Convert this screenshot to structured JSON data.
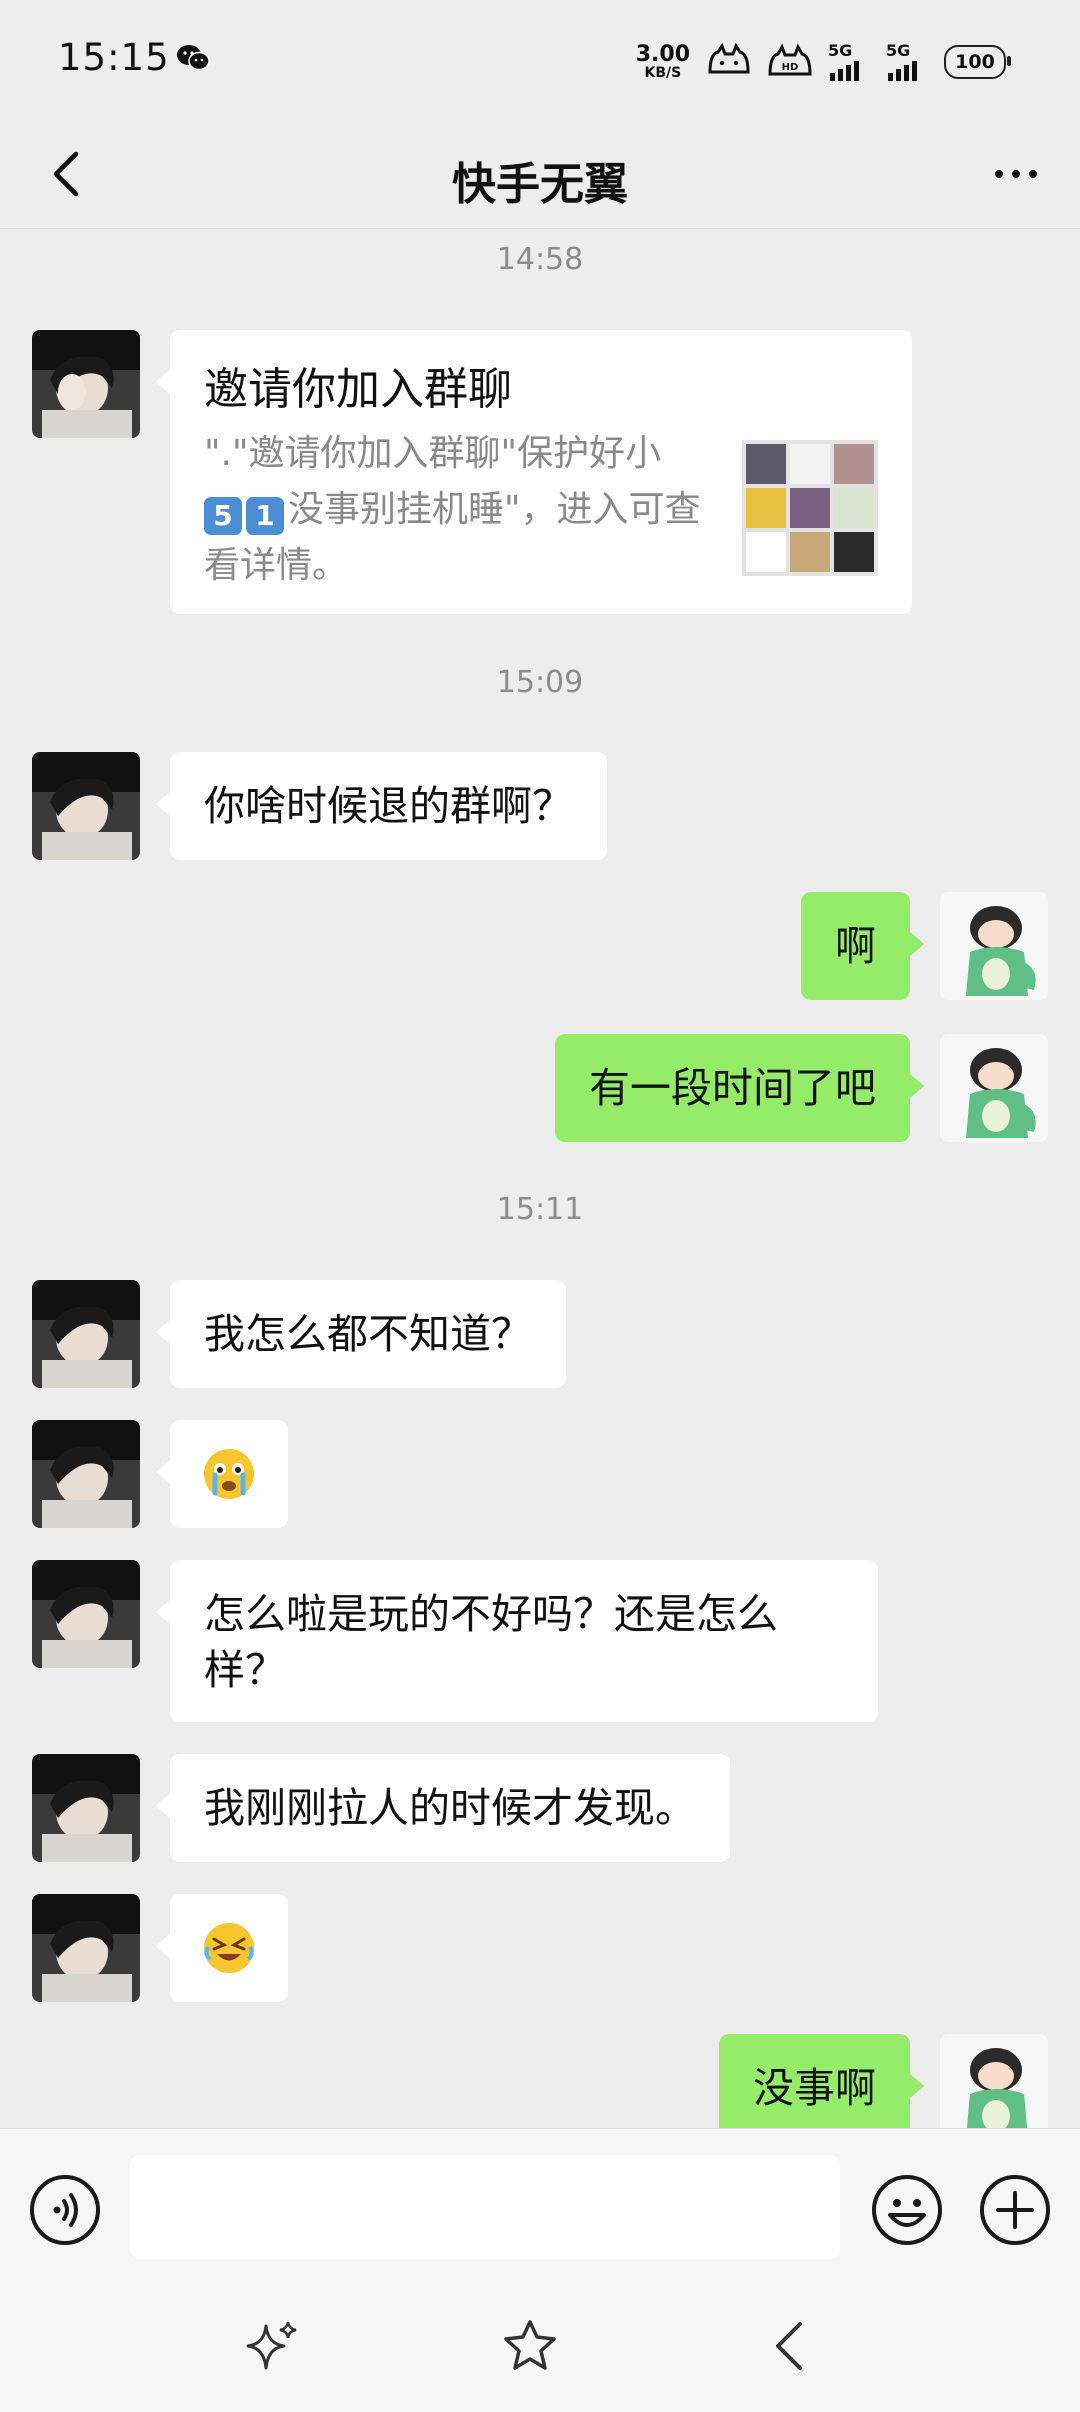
{
  "status_bar": {
    "time": "15:15",
    "net_speed_value": "3.00",
    "net_speed_unit": "KB/S",
    "signal1_label": "5G",
    "signal2_label": "5G",
    "battery_level": "100",
    "icons": [
      "wechat-icon",
      "cat-hd-icon",
      "signal-5g-icon",
      "signal-5g-icon",
      "battery-icon"
    ]
  },
  "header": {
    "title": "快手无翼"
  },
  "messages": {
    "ts1": "14:58",
    "invite": {
      "title": "邀请你加入群聊",
      "desc_part1": "\".\"邀请你加入群聊\"保护好小",
      "badge1": "5",
      "badge2": "1",
      "desc_part2": "没事别挂机睡\"，进入可查看详情。"
    },
    "ts2": "15:09",
    "m1": "你啥时候退的群啊？",
    "m2": "啊",
    "m3": "有一段时间了吧",
    "ts3": "15:11",
    "m4": "我怎么都不知道？",
    "m5_emoji": "😭",
    "m6": "怎么啦是玩的不好吗？还是怎么样？",
    "m7": "我刚刚拉人的时候才发现。",
    "m8_emoji": "😂",
    "m9": "没事啊"
  },
  "input_bar": {
    "placeholder": ""
  },
  "colors": {
    "bg": "#ededed",
    "sent_bubble": "#95ec69",
    "received_bubble": "#ffffff",
    "timestamp": "#8c8c8c"
  }
}
